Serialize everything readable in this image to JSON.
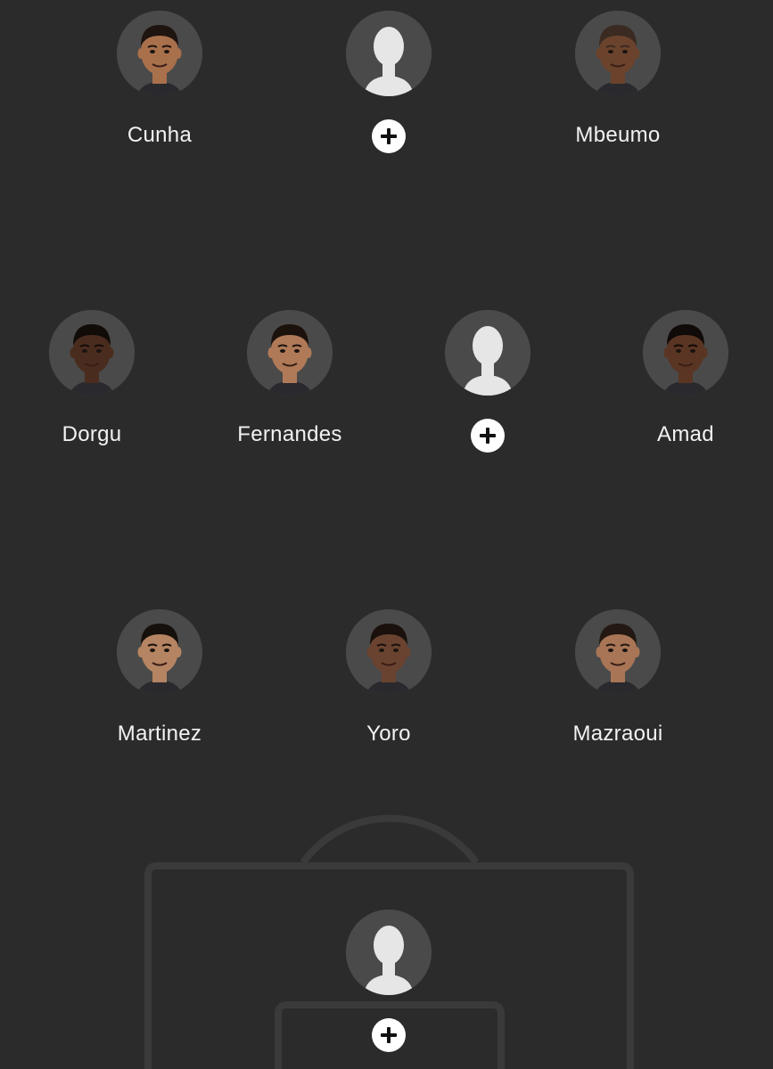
{
  "colors": {
    "background": "#2b2b2b",
    "avatar_bg": "#4a4a4a",
    "pitch_line": "#3a3a3a",
    "text": "#f2f2f2",
    "add_button": "#ffffff"
  },
  "forwards": [
    {
      "name": "Cunha",
      "filled": true,
      "skin": "#a9704c",
      "hair": "#1e1410"
    },
    {
      "name": "",
      "filled": false,
      "action_icon": "plus-icon"
    },
    {
      "name": "Mbeumo",
      "filled": true,
      "skin": "#6b432c",
      "hair": "#3a2a22"
    }
  ],
  "midfielders": [
    {
      "name": "Dorgu",
      "filled": true,
      "skin": "#4a2c1e",
      "hair": "#120c09"
    },
    {
      "name": "Fernandes",
      "filled": true,
      "skin": "#b07a58",
      "hair": "#1c120c"
    },
    {
      "name": "",
      "filled": false,
      "action_icon": "plus-icon"
    },
    {
      "name": "Amad",
      "filled": true,
      "skin": "#5a3523",
      "hair": "#100a08"
    }
  ],
  "defenders": [
    {
      "name": "Martinez",
      "filled": true,
      "skin": "#b58462",
      "hair": "#16100c"
    },
    {
      "name": "Yoro",
      "filled": true,
      "skin": "#6a4330",
      "hair": "#1a110c"
    },
    {
      "name": "Mazraoui",
      "filled": true,
      "skin": "#a87657",
      "hair": "#231812"
    }
  ],
  "goalkeeper": {
    "name": "",
    "filled": false,
    "action_icon": "plus-icon"
  }
}
